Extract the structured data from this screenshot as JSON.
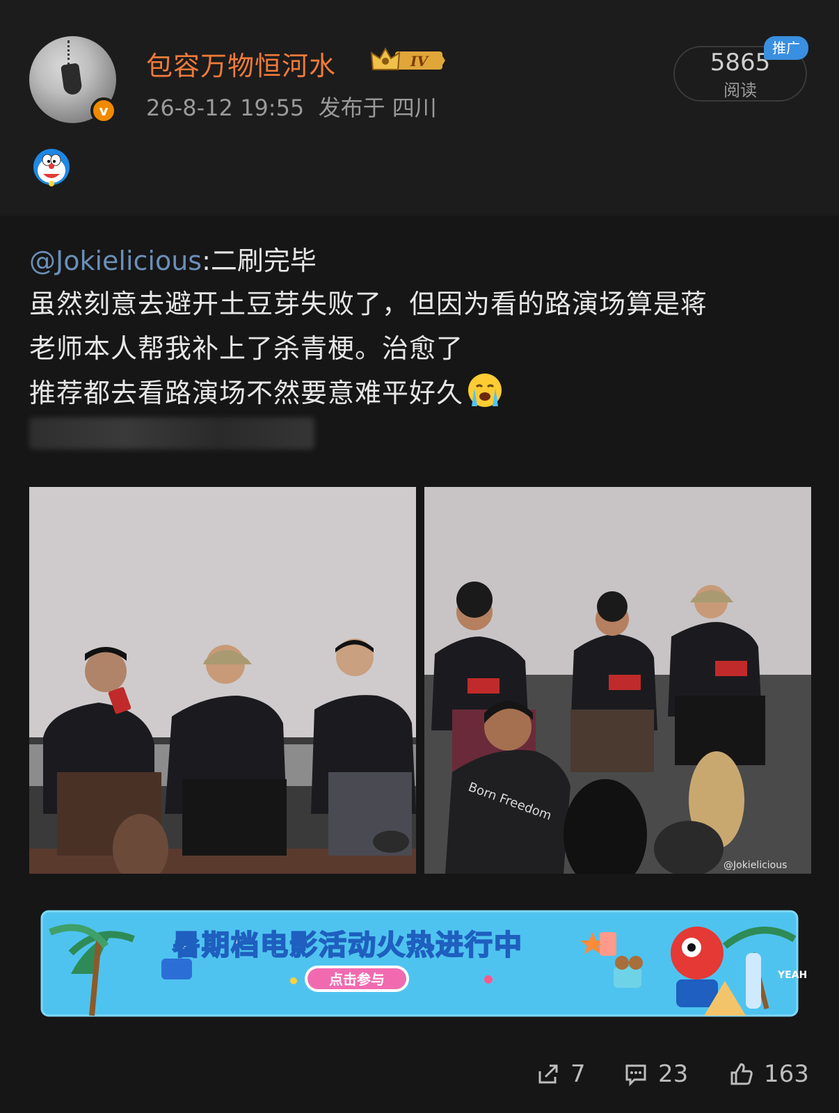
{
  "post": {
    "author": "包容万物恒河水",
    "level_badge": "IV",
    "timestamp": "26-8-12 19:55",
    "location_text": "发布于 四川",
    "read_count": "5865",
    "read_label": "阅读",
    "promo_tag": "推广",
    "mention": "@Jokielicious",
    "mention_suffix": ":二刷完毕",
    "lines": [
      "虽然刻意去避开土豆芽失败了，但因为看的路演场算是蒋",
      "老师本人帮我补上了杀青梗。治愈了",
      "推荐都去看路演场不然要意难平好久"
    ],
    "photo2_watermark": "@Jokielicious",
    "shirt_text": "Born Freedom"
  },
  "banner": {
    "title": "暑期档电影活动火热进行中",
    "button": "点击参与",
    "badge": "YEAH"
  },
  "actions": {
    "share_count": "7",
    "comment_count": "23",
    "like_count": "163"
  },
  "colors": {
    "username": "#f07a3a",
    "mention": "#6b8fb8",
    "verified": "#f08a00",
    "promo": "#3a8fe0",
    "banner_bg": "#4fc3ef"
  }
}
